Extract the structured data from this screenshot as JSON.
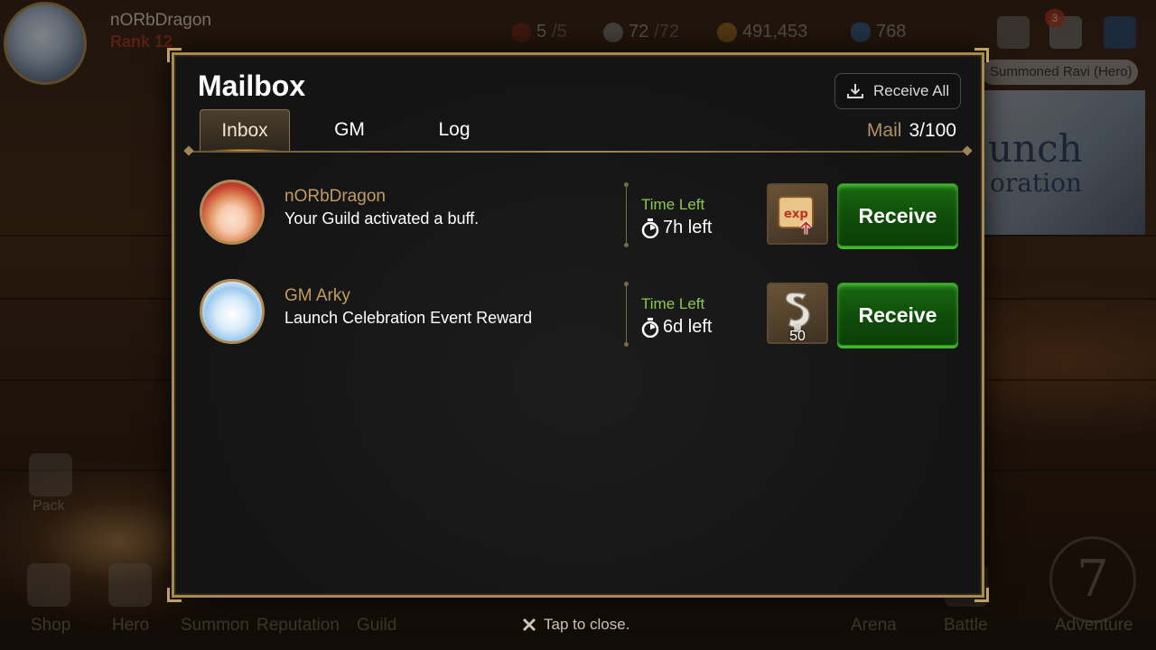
{
  "hud": {
    "player_name": "nORbDragon",
    "rank": "Rank 12",
    "stamina": "5",
    "stamina_max": "/5",
    "keys": "72",
    "keys_max": "/72",
    "gold": "491,453",
    "crystals": "768",
    "mail_badge": "3"
  },
  "side": {
    "banner_text": "Summoned Ravi (Hero)",
    "event_title_1": "unch",
    "event_title_2": "oration"
  },
  "nav": {
    "pack": "Pack",
    "shop": "Shop",
    "hero": "Hero",
    "summon": "Summon",
    "reputation": "Reputation",
    "guild": "Guild",
    "arena": "Arena",
    "battle": "Battle",
    "adventure": "Adventure",
    "adventure_glyph": "7"
  },
  "mailbox": {
    "title": "Mailbox",
    "receive_all": "Receive All",
    "tabs": [
      {
        "label": "Inbox",
        "active": true
      },
      {
        "label": "GM",
        "active": false
      },
      {
        "label": "Log",
        "active": false
      }
    ],
    "mail_label": "Mail",
    "mail_count": "3/100",
    "items": [
      {
        "sender": "nORbDragon",
        "message": "Your Guild activated a buff.",
        "time_label": "Time Left",
        "time_value": "7h left",
        "reward_icon": "exp-scroll-icon",
        "reward_qty": "",
        "button": "Receive"
      },
      {
        "sender": "GM Arky",
        "message": "Launch Celebration Event Reward",
        "time_label": "Time Left",
        "time_value": "6d left",
        "reward_icon": "key-icon",
        "reward_qty": "50",
        "button": "Receive"
      }
    ],
    "close_hint": "Tap to close."
  },
  "colors": {
    "accent_gold": "#a8894f",
    "sender_gold": "#c39b63",
    "time_green": "#8cc84e",
    "receive_green": "#1a6a12"
  }
}
